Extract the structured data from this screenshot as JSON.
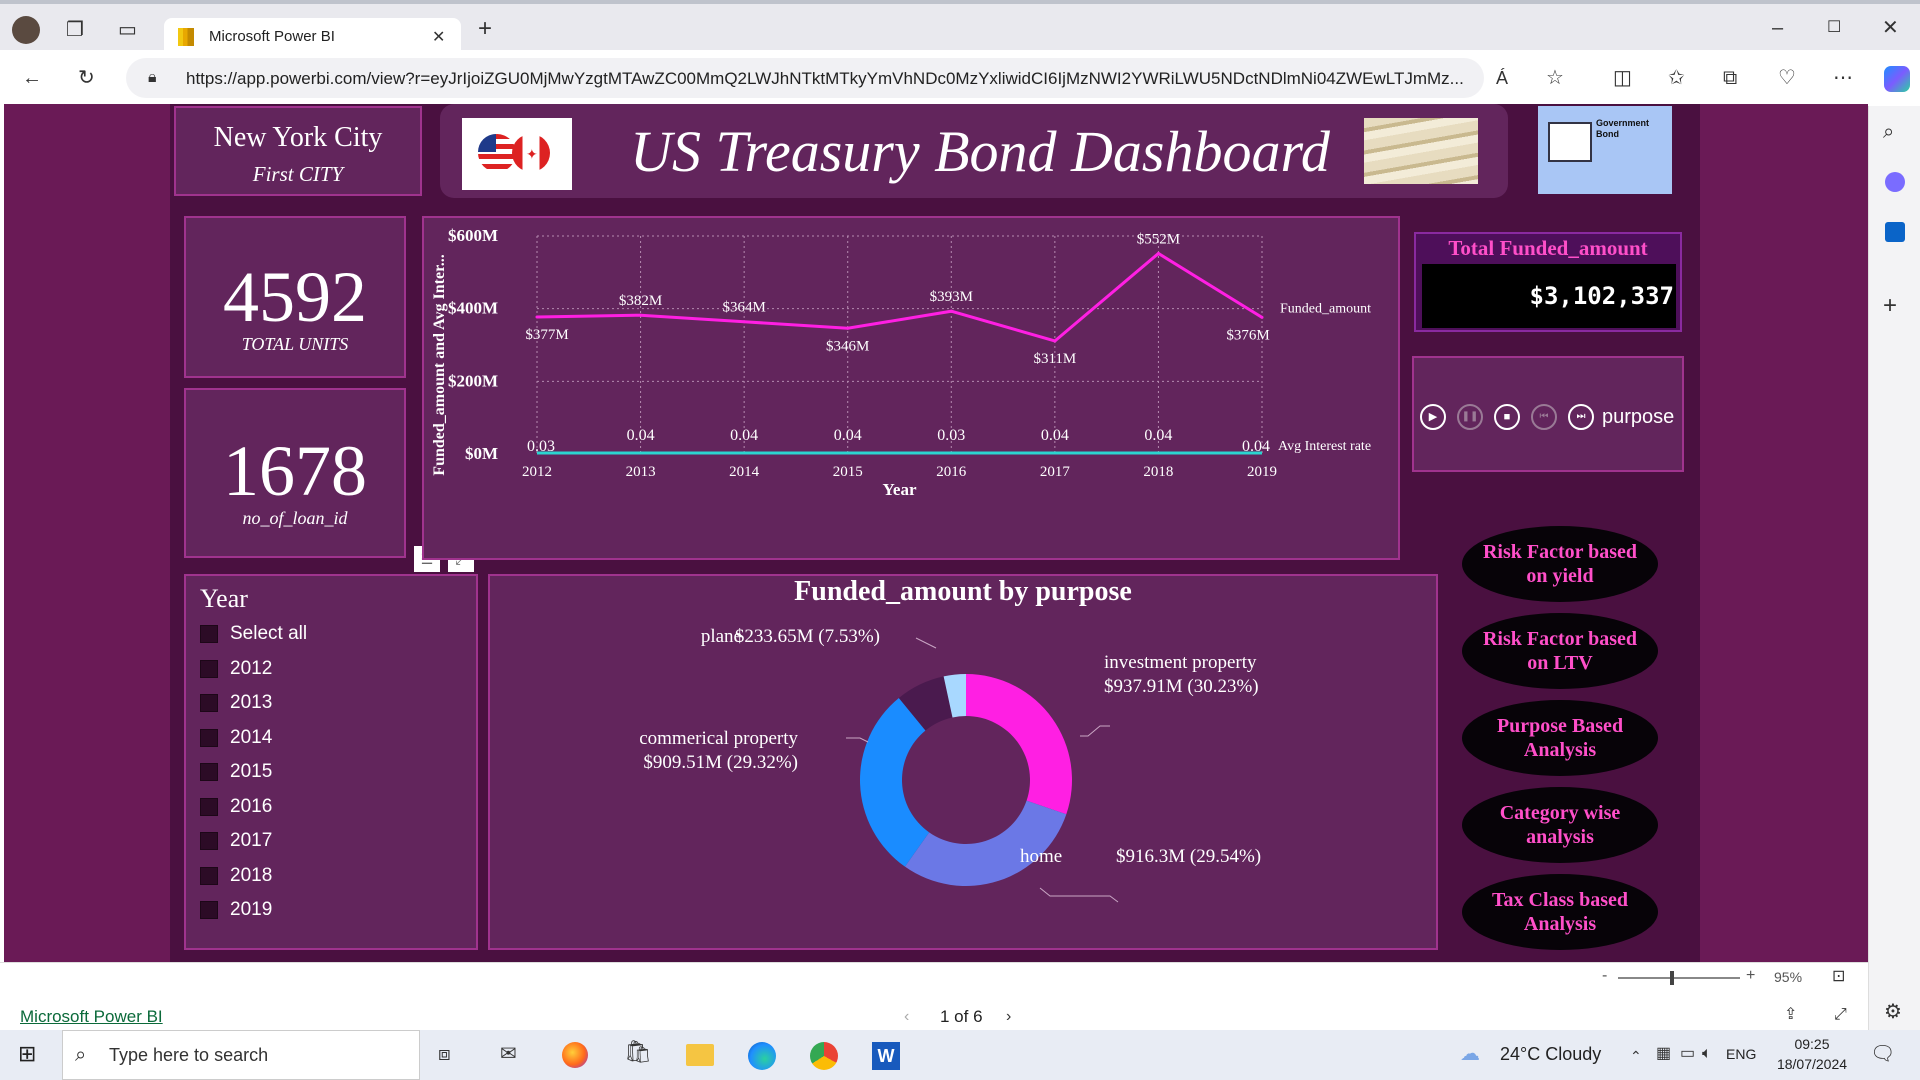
{
  "browser": {
    "tab_title": "Microsoft Power BI",
    "url": "https://app.powerbi.com/view?r=eyJrIjoiZGU0MjMwYzgtMTAwZC00MmQ2LWJhNTktMTkyYmVhNDc0MzYxliwidCI6IjMzNWI2YWRiLWU5NDctNDlmNi04ZWEwLTJmMz...",
    "read_aloud": "Á"
  },
  "report": {
    "city_title": "New York City",
    "city_subtitle": "First CITY",
    "dashboard_title": "US Treasury Bond Dashboard",
    "gov_bond_title": "Government Bond",
    "kpi1": {
      "value": "4592",
      "label": "TOTAL UNITS"
    },
    "kpi2": {
      "value": "1678",
      "label": "no_of_loan_id"
    },
    "total_funded": {
      "title": "Total Funded_amount",
      "value": "$3,102,337"
    },
    "play_axis": {
      "label": "purpose"
    },
    "slicer": {
      "title": "Year",
      "items": [
        "Select all",
        "2012",
        "2013",
        "2014",
        "2015",
        "2016",
        "2017",
        "2018",
        "2019"
      ]
    },
    "nav_buttons": [
      "Risk Factor based on yield",
      "Risk Factor based on LTV",
      "Purpose Based Analysis",
      "Category wise analysis",
      "Tax Class based Analysis"
    ],
    "colors": {
      "funded_line": "#ff1fe3",
      "interest_line": "#2bd4d0",
      "canvas": "#6a1a56",
      "card": "#62255c"
    }
  },
  "chart_data": [
    {
      "type": "line",
      "title": "",
      "xlabel": "Year",
      "ylabel": "Funded_amount and Avg Inter...",
      "x": [
        "2012",
        "2013",
        "2014",
        "2015",
        "2016",
        "2017",
        "2018",
        "2019"
      ],
      "y_ticks": [
        "$0M",
        "$200M",
        "$400M",
        "$600M"
      ],
      "ylim": [
        0,
        600
      ],
      "grid": true,
      "series": [
        {
          "name": "Funded_amount",
          "values": [
            377,
            382,
            364,
            346,
            393,
            311,
            552,
            376
          ],
          "labels": [
            "$377M",
            "$382M",
            "$364M",
            "$346M",
            "$393M",
            "$311M",
            "$552M",
            "$376M"
          ]
        },
        {
          "name": "Avg Interest rate",
          "values": [
            0.03,
            0.04,
            0.04,
            0.04,
            0.03,
            0.04,
            0.04,
            0.04
          ],
          "labels": [
            "0.03",
            "0.04",
            "0.04",
            "0.04",
            "0.03",
            "0.04",
            "0.04",
            "0.04"
          ]
        }
      ]
    },
    {
      "type": "pie",
      "title": "Funded_amount by purpose",
      "slices": [
        {
          "name": "investment property",
          "value": 937.91,
          "label": "$937.91M (30.23%)",
          "color": "#ff1fe3"
        },
        {
          "name": "home",
          "value": 916.3,
          "label": "$916.3M (29.54%)",
          "color": "#6b78e6"
        },
        {
          "name": "commerical property",
          "value": 909.51,
          "label": "$909.51M (29.32%)",
          "color": "#1a8cff"
        },
        {
          "name": "plane",
          "value": 233.65,
          "label": "$233.65M (7.53%)",
          "color": "#4a1a4e"
        },
        {
          "name": "",
          "value": 104.97,
          "label": "",
          "color": "#a8d8ff"
        }
      ]
    }
  ],
  "statusbar": {
    "app_link": "Microsoft Power BI",
    "page": "1 of 6",
    "zoom": "95%",
    "zoom_minus": "-",
    "zoom_plus": "+"
  },
  "taskbar": {
    "search_placeholder": "Type here to search",
    "weather": "24°C  Cloudy",
    "lang": "ENG",
    "time": "09:25",
    "date": "18/07/2024"
  }
}
